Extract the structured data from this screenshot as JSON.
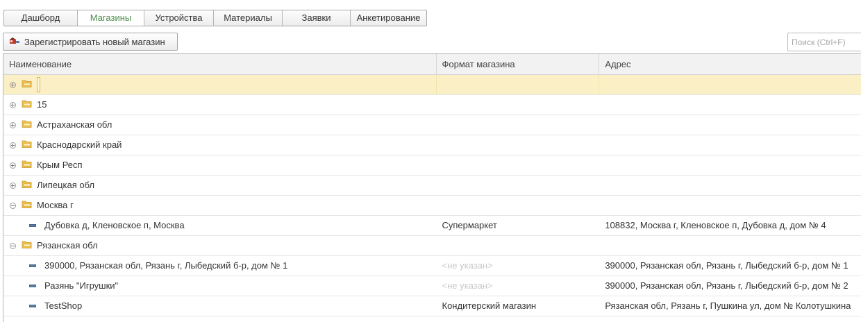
{
  "tabs": [
    {
      "label": "Дашборд",
      "active": false
    },
    {
      "label": "Магазины",
      "active": true
    },
    {
      "label": "Устройства",
      "active": false
    },
    {
      "label": "Материалы",
      "active": false
    },
    {
      "label": "Заявки",
      "active": false
    },
    {
      "label": "Анкетирование",
      "active": false
    }
  ],
  "toolbar": {
    "register_label": "Зарегистрировать новый магазин"
  },
  "search": {
    "placeholder": "Поиск (Ctrl+F)",
    "value": ""
  },
  "table": {
    "columns": [
      "Наименование",
      "Формат магазина",
      "Адрес"
    ],
    "rows": [
      {
        "kind": "group",
        "expander": "plus",
        "name": "",
        "format": "",
        "address": "",
        "selected": true
      },
      {
        "kind": "group",
        "expander": "plus",
        "name": "15",
        "format": "",
        "address": ""
      },
      {
        "kind": "group",
        "expander": "plus",
        "name": "Астраханская обл",
        "format": "",
        "address": ""
      },
      {
        "kind": "group",
        "expander": "plus",
        "name": "Краснодарский край",
        "format": "",
        "address": ""
      },
      {
        "kind": "group",
        "expander": "plus",
        "name": "Крым Респ",
        "format": "",
        "address": ""
      },
      {
        "kind": "group",
        "expander": "plus",
        "name": "Липецкая обл",
        "format": "",
        "address": ""
      },
      {
        "kind": "group",
        "expander": "minus",
        "name": "Москва г",
        "format": "",
        "address": ""
      },
      {
        "kind": "item",
        "name": "Дубовка д, Кленовское п, Москва",
        "format": "Супермаркет",
        "address": "108832, Москва г, Кленовское п, Дубовка д, дом № 4"
      },
      {
        "kind": "group",
        "expander": "minus",
        "name": "Рязанская обл",
        "format": "",
        "address": ""
      },
      {
        "kind": "item",
        "name": "390000, Рязанская обл, Рязань г, Лыбедский б-р, дом № 1",
        "format": "<не указан>",
        "format_dim": true,
        "address": "390000, Рязанская обл, Рязань г, Лыбедский б-р, дом № 1"
      },
      {
        "kind": "item",
        "name": "Разянь \"Игрушки\"",
        "format": "<не указан>",
        "format_dim": true,
        "address": "390000, Рязанская обл, Рязань г, Лыбедский б-р, дом № 2"
      },
      {
        "kind": "item",
        "name": "TestShop",
        "format": "Кондитерский магазин",
        "address": "Рязанская обл, Рязань г, Пушкина ул, дом № Колотушкина"
      }
    ]
  },
  "colors": {
    "accent_tab": "#4b8d4b",
    "selected_row": "#fbefc5",
    "folder": "#e8b73a"
  },
  "icons": {
    "folder": "folder-icon",
    "item": "catalog-item-icon",
    "register": "shop-register-icon"
  }
}
